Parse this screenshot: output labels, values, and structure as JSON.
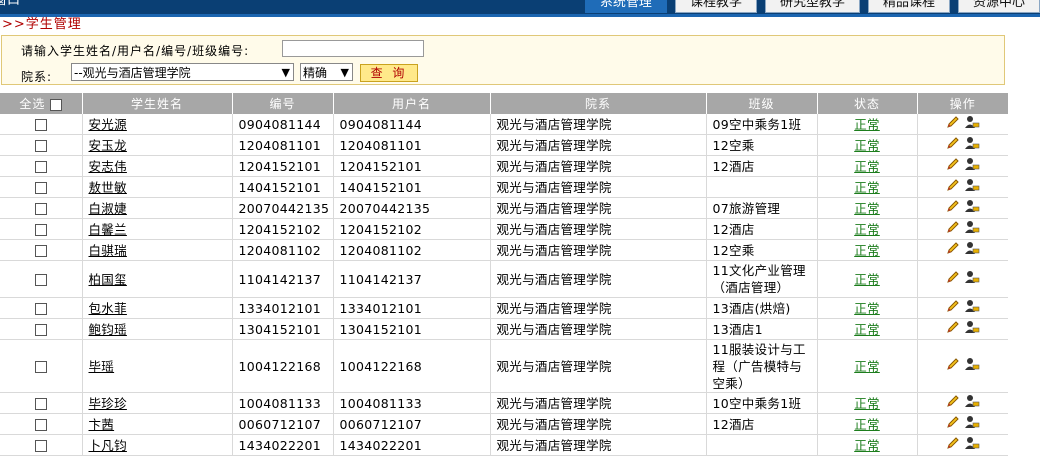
{
  "topbar": {
    "corner_text": "窗口",
    "tabs": [
      {
        "label": "系统管理",
        "active": true
      },
      {
        "label": "课程教学",
        "active": false
      },
      {
        "label": "研究型教学",
        "active": false
      },
      {
        "label": "精品课程",
        "active": false
      },
      {
        "label": "资源中心",
        "active": false
      }
    ]
  },
  "breadcrumb": ">>学生管理",
  "search": {
    "keyword_label": "请输入学生姓名/用户名/编号/班级编号:",
    "keyword_value": "",
    "dept_label": "院系:",
    "dept_selected": "--观光与酒店管理学院",
    "mode_selected": "精确",
    "query_label": "查 询"
  },
  "table": {
    "headers": {
      "select_all": "全选",
      "name": "学生姓名",
      "number": "编号",
      "username": "用户名",
      "dept": "院系",
      "class": "班级",
      "status": "状态",
      "ops": "操作"
    },
    "rows": [
      {
        "name": "安光源",
        "number": "0904081144",
        "username": "0904081144",
        "dept": "观光与酒店管理学院",
        "class": "09空中乘务1班",
        "status": "正常",
        "height": "h1"
      },
      {
        "name": "安玉龙",
        "number": "1204081101",
        "username": "1204081101",
        "dept": "观光与酒店管理学院",
        "class": "12空乘",
        "status": "正常",
        "height": "h1"
      },
      {
        "name": "安志伟",
        "number": "1204152101",
        "username": "1204152101",
        "dept": "观光与酒店管理学院",
        "class": "12酒店",
        "status": "正常",
        "height": "h1"
      },
      {
        "name": "敖世敏",
        "number": "1404152101",
        "username": "1404152101",
        "dept": "观光与酒店管理学院",
        "class": "",
        "status": "正常",
        "height": "h1"
      },
      {
        "name": "白淑婕",
        "number": "20070442135",
        "username": "20070442135",
        "dept": "观光与酒店管理学院",
        "class": "07旅游管理",
        "status": "正常",
        "height": "h1"
      },
      {
        "name": "白馨兰",
        "number": "1204152102",
        "username": "1204152102",
        "dept": "观光与酒店管理学院",
        "class": "12酒店",
        "status": "正常",
        "height": "h1"
      },
      {
        "name": "白骐瑞",
        "number": "1204081102",
        "username": "1204081102",
        "dept": "观光与酒店管理学院",
        "class": "12空乘",
        "status": "正常",
        "height": "h1"
      },
      {
        "name": "柏国玺",
        "number": "1104142137",
        "username": "1104142137",
        "dept": "观光与酒店管理学院",
        "class": "11文化产业管理（酒店管理）",
        "status": "正常",
        "height": "h2"
      },
      {
        "name": "包水菲",
        "number": "1334012101",
        "username": "1334012101",
        "dept": "观光与酒店管理学院",
        "class": "13酒店(烘焙)",
        "status": "正常",
        "height": "h1"
      },
      {
        "name": "鲍钧瑶",
        "number": "1304152101",
        "username": "1304152101",
        "dept": "观光与酒店管理学院",
        "class": "13酒店1",
        "status": "正常",
        "height": "h1"
      },
      {
        "name": "毕瑶",
        "number": "1004122168",
        "username": "1004122168",
        "dept": "观光与酒店管理学院",
        "class": "11服装设计与工程（广告模特与空乘）",
        "status": "正常",
        "height": "h3"
      },
      {
        "name": "毕珍珍",
        "number": "1004081133",
        "username": "1004081133",
        "dept": "观光与酒店管理学院",
        "class": "10空中乘务1班",
        "status": "正常",
        "height": "h1"
      },
      {
        "name": "卞茜",
        "number": "0060712107",
        "username": "0060712107",
        "dept": "观光与酒店管理学院",
        "class": "12酒店",
        "status": "正常",
        "height": "h1"
      },
      {
        "name": "卜凡钧",
        "number": "1434022201",
        "username": "1434022201",
        "dept": "观光与酒店管理学院",
        "class": "",
        "status": "正常",
        "height": "h1"
      }
    ]
  }
}
